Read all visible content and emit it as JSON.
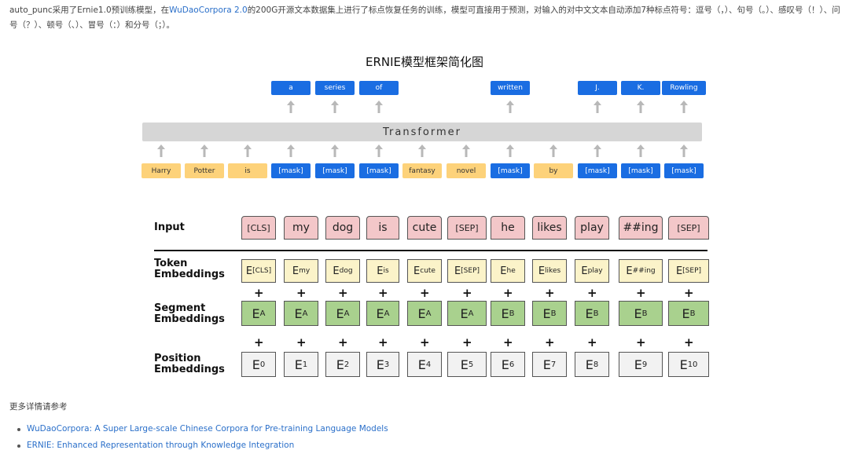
{
  "intro": {
    "part1": "auto_punc采用了Ernie1.0预训练模型，在",
    "link": "WuDaoCorpora 2.0",
    "part2": "的200G开源文本数据集上进行了标点恢复任务的训练，模型可直接用于预测，对输入的对中文文本自动添加7种标点符号：逗号（，）、句号（。）、感叹号（！）、问号（？）、顿号（、）、冒号（：）和分号（；）。"
  },
  "ernie": {
    "title": "ERNIE模型框架简化图",
    "transformer_label": "Transformer",
    "top_tokens": [
      "a",
      "series",
      "of",
      "written",
      "J.",
      "K.",
      "Rowling"
    ],
    "bottom_tokens": [
      "Harry",
      "Potter",
      "is",
      "[mask]",
      "[mask]",
      "[mask]",
      "fantasy",
      "novel",
      "[mask]",
      "by",
      "[mask]",
      "[mask]",
      "[mask]"
    ]
  },
  "bert": {
    "labels": {
      "input": "Input",
      "token_l1": "Token",
      "token_l2": "Embeddings",
      "segment_l1": "Segment",
      "segment_l2": "Embeddings",
      "position_l1": "Position",
      "position_l2": "Embeddings"
    },
    "input_tokens": [
      "[CLS]",
      "my",
      "dog",
      "is",
      "cute",
      "[SEP]",
      "he",
      "likes",
      "play",
      "##ing",
      "[SEP]"
    ],
    "token_emb": [
      "[CLS]",
      "my",
      "dog",
      "is",
      "cute",
      "[SEP]",
      "he",
      "likes",
      "play",
      "##ing",
      "[SEP]"
    ],
    "segment_emb": [
      "A",
      "A",
      "A",
      "A",
      "A",
      "A",
      "B",
      "B",
      "B",
      "B",
      "B"
    ],
    "position_emb": [
      "0",
      "1",
      "2",
      "3",
      "4",
      "5",
      "6",
      "7",
      "8",
      "9",
      "10"
    ],
    "emb_letter": "E",
    "plus": "+"
  },
  "more": {
    "heading": "更多详情请参考",
    "refs": [
      "WuDaoCorpora: A Super Large-scale Chinese Corpora for Pre-training Language Models",
      "ERNIE: Enhanced Representation through Knowledge Integration"
    ]
  }
}
